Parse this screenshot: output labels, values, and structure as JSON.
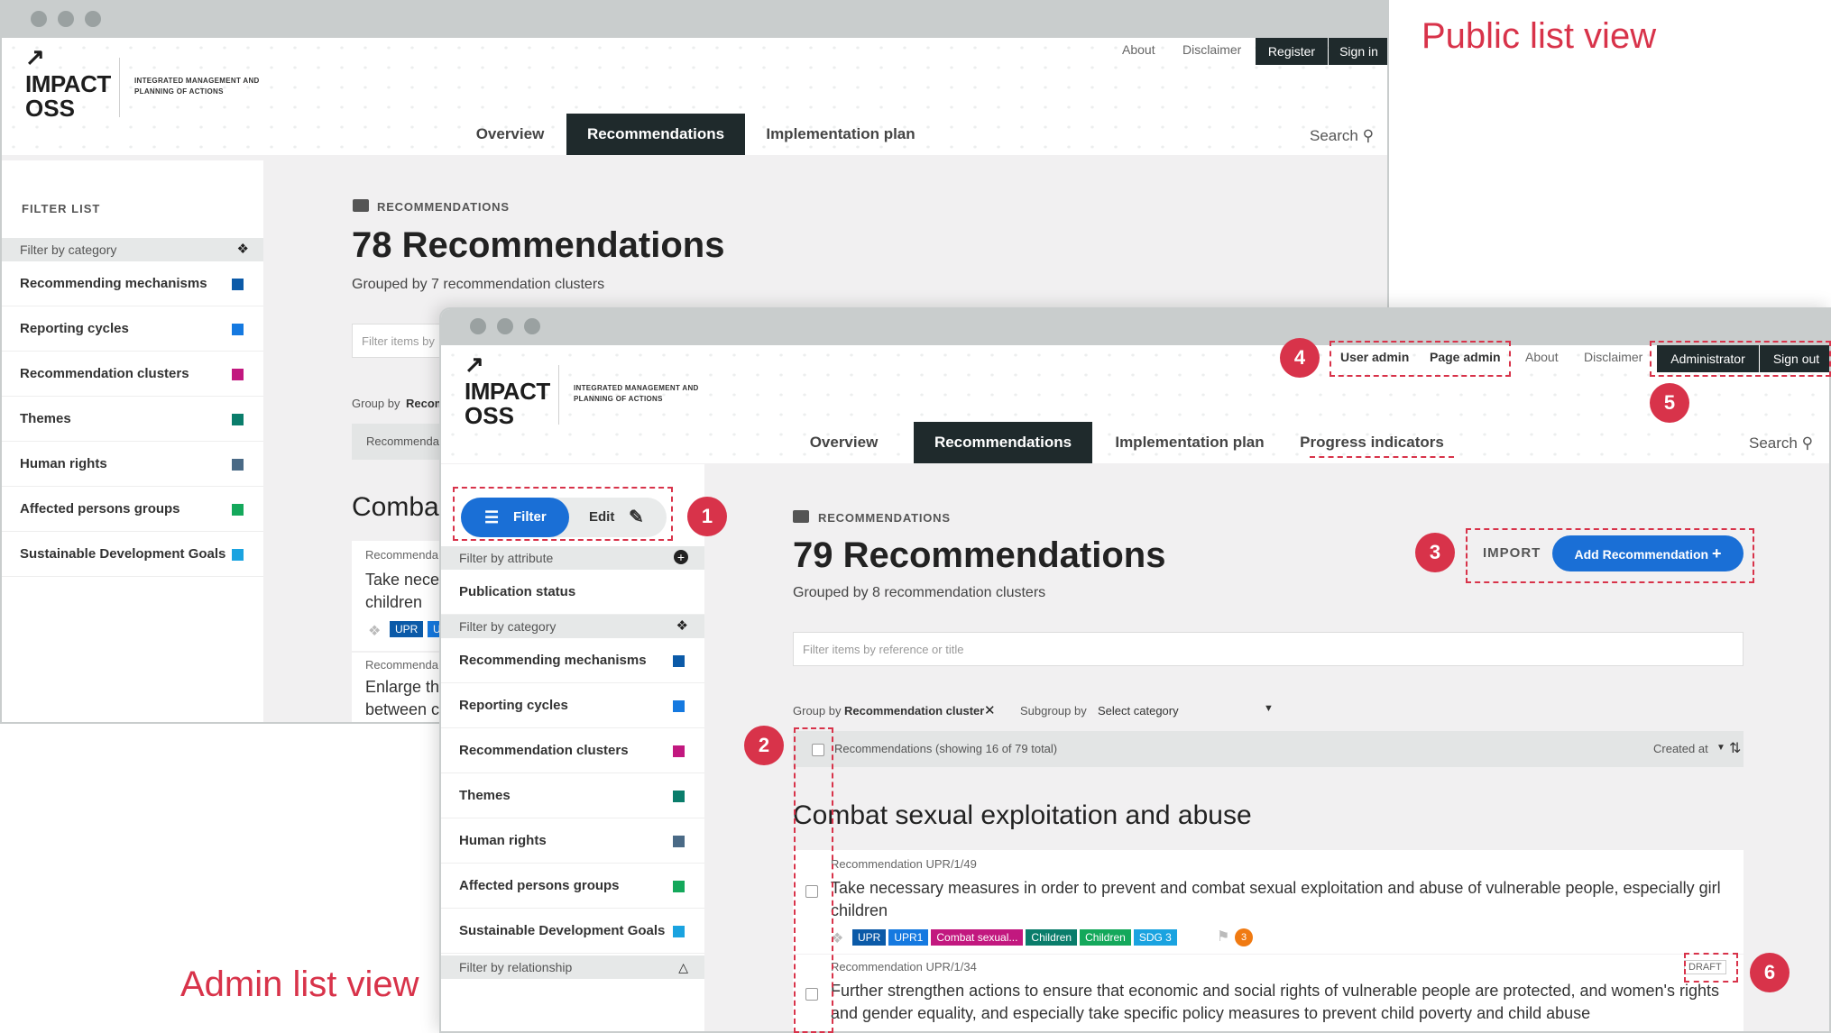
{
  "captions": {
    "public": "Public list view",
    "admin": "Admin list view"
  },
  "brand": {
    "impact": "IMPACT",
    "oss": "OSS",
    "tagline": "INTEGRATED MANAGEMENT AND PLANNING OF ACTIONS"
  },
  "public": {
    "toplinks": {
      "about": "About",
      "disclaimer": "Disclaimer",
      "register": "Register",
      "signin": "Sign in"
    },
    "nav": {
      "overview": "Overview",
      "recommendations": "Recommendations",
      "implementation": "Implementation plan",
      "search": "Search"
    },
    "sidebar": {
      "title": "FILTER LIST",
      "group": "Filter by category",
      "items": [
        {
          "label": "Recommending mechanisms",
          "color": "#0b5aa8"
        },
        {
          "label": "Reporting cycles",
          "color": "#1579e0"
        },
        {
          "label": "Recommendation clusters",
          "color": "#c2187f"
        },
        {
          "label": "Themes",
          "color": "#0a7d6b"
        },
        {
          "label": "Human rights",
          "color": "#4a6a86"
        },
        {
          "label": "Affected persons groups",
          "color": "#14a85b"
        },
        {
          "label": "Sustainable Development Goals",
          "color": "#1aa3e0"
        }
      ]
    },
    "main": {
      "kicker": "RECOMMENDATIONS",
      "title": "78 Recommendations",
      "subtitle": "Grouped by 7 recommendation clusters",
      "filter_placeholder": "Filter items by",
      "groupby_label": "Group by",
      "groupby_value": "Recom",
      "bar_text": "Recommendat",
      "section": "Combat",
      "card1_ref": "Recommenda",
      "card1_text_a": "Take neces",
      "card1_text_b": "children",
      "card1_badges": [
        "UPR",
        "U"
      ],
      "card2_ref": "Recommenda",
      "card2_text_a": "Enlarge the",
      "card2_text_b": "between ch"
    }
  },
  "admin": {
    "toplinks": {
      "useradmin": "User admin",
      "pageadmin": "Page admin",
      "about": "About",
      "disclaimer": "Disclaimer",
      "administrator": "Administrator",
      "signout": "Sign out"
    },
    "nav": {
      "overview": "Overview",
      "recommendations": "Recommendations",
      "implementation": "Implementation plan",
      "progress": "Progress indicators",
      "search": "Search"
    },
    "sidebar": {
      "filter_btn": "Filter",
      "edit_btn": "Edit",
      "attr_group": "Filter by attribute",
      "attr_item": "Publication status",
      "cat_group": "Filter by category",
      "items": [
        {
          "label": "Recommending mechanisms",
          "color": "#0b5aa8"
        },
        {
          "label": "Reporting cycles",
          "color": "#1579e0"
        },
        {
          "label": "Recommendation clusters",
          "color": "#c2187f"
        },
        {
          "label": "Themes",
          "color": "#0a7d6b"
        },
        {
          "label": "Human rights",
          "color": "#4a6a86"
        },
        {
          "label": "Affected persons groups",
          "color": "#14a85b"
        },
        {
          "label": "Sustainable Development Goals",
          "color": "#1aa3e0"
        }
      ],
      "rel_group": "Filter by relationship"
    },
    "main": {
      "kicker": "RECOMMENDATIONS",
      "title": "79 Recommendations",
      "subtitle": "Grouped by 8 recommendation clusters",
      "import": "IMPORT",
      "add": "Add Recommendation",
      "filter_placeholder": "Filter items by reference or title",
      "groupby_label": "Group by",
      "groupby_value": "Recommendation cluster",
      "subgroup_label": "Subgroup by",
      "subgroup_value": "Select category",
      "list_header": "Recommendations (showing 16 of 79 total)",
      "sort_label": "Created at",
      "section": "Combat sexual exploitation and abuse",
      "card1": {
        "ref": "Recommendation UPR/1/49",
        "text_a": "Take necessary measures in order to prevent and combat sexual exploitation and abuse of vulnerable people, especially girl",
        "text_b": "children",
        "badges": [
          {
            "label": "UPR",
            "color": "#0b5aa8"
          },
          {
            "label": "UPR1",
            "color": "#1579e0"
          },
          {
            "label": "Combat sexual...",
            "color": "#c2187f"
          },
          {
            "label": "Children",
            "color": "#0a7d6b"
          },
          {
            "label": "Children",
            "color": "#14a85b"
          },
          {
            "label": "SDG 3",
            "color": "#1aa3e0"
          }
        ],
        "count": "3"
      },
      "card2": {
        "ref": "Recommendation UPR/1/34",
        "status": "DRAFT",
        "text_a": "Further strengthen actions to ensure that economic and social rights of vulnerable people are protected, and women's rights",
        "text_b": "and gender equality, and especially take specific policy measures to prevent child poverty and child abuse"
      }
    },
    "markers": [
      "1",
      "2",
      "3",
      "4",
      "5",
      "6"
    ]
  }
}
